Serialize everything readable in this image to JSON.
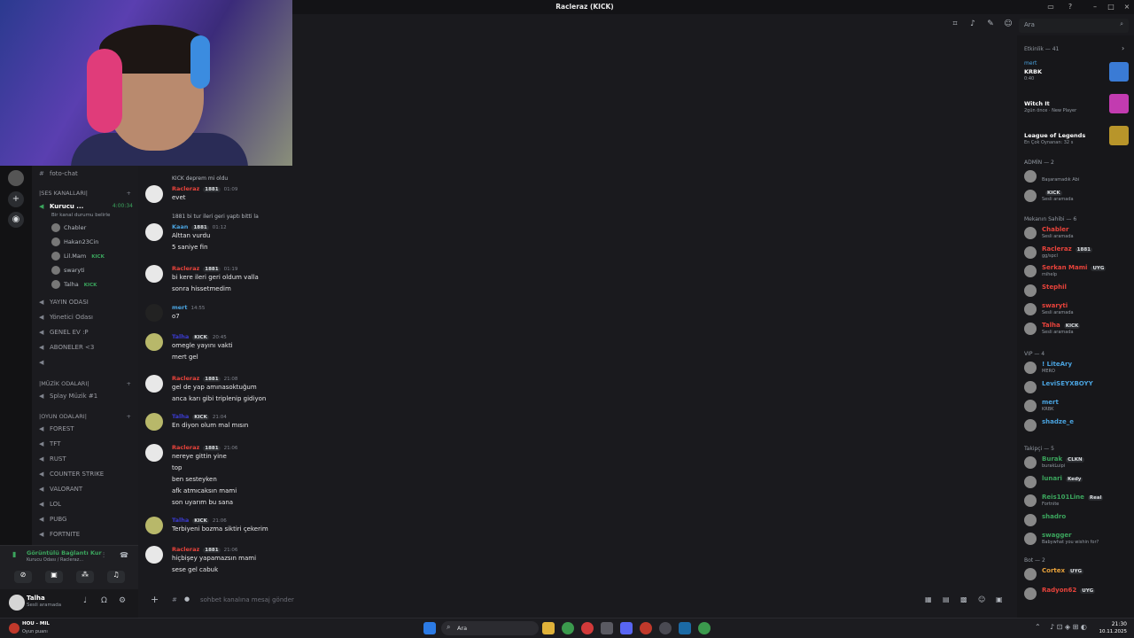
{
  "window": {
    "title": "Racleraz (KICK)"
  },
  "channel": {
    "name": "foto-chat",
    "composer_placeholder": "sohbet kanalına mesaj gönder"
  },
  "search": {
    "placeholder": "Ara"
  },
  "sidebar": {
    "top_channel": "foto-chat",
    "categories": {
      "ses": "|SES KANALLARI|",
      "muzik": "|MÜZİK ODALARI|",
      "oyun": "|OYUN ODALARI|"
    },
    "active_voice": {
      "name": "Kurucu ...",
      "time": "4:00:34",
      "status": "Bir kanal durumu belirle"
    },
    "voice_users": [
      {
        "name": "Chabler",
        "badge": ""
      },
      {
        "name": "Hakan23Cin",
        "badge": ""
      },
      {
        "name": "Lil.Mam",
        "badge": "KICK"
      },
      {
        "name": "swaryti",
        "badge": ""
      },
      {
        "name": "Talha",
        "badge": "KICK"
      }
    ],
    "channels": [
      "YAYIN ODASI",
      "Yönetici Odası",
      "GENEL EV :P",
      "ABONELER <3",
      ""
    ],
    "music_channels": [
      "Splay Müzik #1"
    ],
    "game_channels": [
      "FOREST",
      "TFT",
      "RUST",
      "COUNTER STRIKE",
      "VALORANT",
      "LOL",
      "PUBG",
      "FORTNITE"
    ]
  },
  "voice_connection": {
    "status": "Görüntülü Bağlantı Kur",
    "detail": "Kurucu Odası / Racleraz..."
  },
  "user": {
    "name": "Talha",
    "status": "Sesli aramada"
  },
  "messages": [
    {
      "reply": "KICK  deprem mi oldu",
      "author": "Racleraz",
      "badge": "1881",
      "time": "01:09",
      "lines": [
        "evet"
      ],
      "color": "#e8433b"
    },
    {
      "reply": "1881  bi tur ileri geri yaptı bitti la",
      "author": "Kaan",
      "badge": "1881",
      "time": "01:12",
      "lines": [
        "Alttan vurdu",
        "5 saniye fin"
      ],
      "color": "#4aa3df"
    },
    {
      "reply": "",
      "author": "Racleraz",
      "badge": "1881",
      "time": "01:19",
      "lines": [
        "bi kere ileri geri oldum valla",
        "sonra hissetmedim"
      ],
      "color": "#e8433b"
    },
    {
      "reply": "",
      "author": "mert",
      "badge": "",
      "time": "14:55",
      "lines": [
        "o7"
      ],
      "color": "#4aa3df"
    },
    {
      "reply": "",
      "author": "Talha",
      "badge": "KICK",
      "time": "20:45",
      "lines": [
        "omegle yayını vakti",
        "mert gel"
      ],
      "color": "#3b3bd0"
    },
    {
      "reply": "",
      "author": "Racleraz",
      "badge": "1881",
      "time": "21:08",
      "lines": [
        "gel de yap amınasoktuğum",
        "anca karı gibi triplenip gidiyon"
      ],
      "color": "#e8433b"
    },
    {
      "reply": "",
      "author": "Talha",
      "badge": "KICK",
      "time": "21:04",
      "lines": [
        "En diyon olum mal mısın"
      ],
      "color": "#3b3bd0"
    },
    {
      "reply": "",
      "author": "Racleraz",
      "badge": "1881",
      "time": "21:06",
      "lines": [
        "nereye gittin yine",
        "top",
        "ben sesteyken",
        "afk atmıcaksın mami",
        "son uyarım bu sana"
      ],
      "color": "#e8433b"
    },
    {
      "reply": "",
      "author": "Talha",
      "badge": "KICK",
      "time": "21:06",
      "lines": [
        "Terbiyeni bozma siktiri çekerim"
      ],
      "color": "#3b3bd0"
    },
    {
      "reply": "",
      "author": "Racleraz",
      "badge": "1881",
      "time": "21:06",
      "lines": [
        "hiçbişey yapamazsın mami",
        "sese gel cabuk"
      ],
      "color": "#e8433b"
    }
  ],
  "members": {
    "activity_header": "Etkinlik — 41",
    "activities": [
      {
        "user": "mert",
        "game": "KRBK",
        "detail": "0:40",
        "color": "#4aa3df",
        "img": "#3a7bd5"
      },
      {
        "user": "",
        "game": "Witch It",
        "detail": "2gün önce · New Player",
        "color": "#e8433b",
        "img": "#c23bb0"
      },
      {
        "user": "",
        "game": "League of Legends",
        "detail": "En Çok Oynanan: 32 s",
        "color": "#e8433b",
        "img": "#b8952a"
      }
    ],
    "sections": [
      {
        "title": "ADMİN — 2",
        "items": [
          {
            "name": "",
            "status": "Başaramadık Abi",
            "color": "#3b3bd0",
            "badge": ""
          },
          {
            "name": "",
            "status": "Sesli aramada",
            "color": "#3b3bd0",
            "badge": "KICK"
          }
        ]
      },
      {
        "title": "Mekanın Sahibi — 6",
        "items": [
          {
            "name": "Chabler",
            "status": "Sesli aramada",
            "color": "#e8433b",
            "badge": ""
          },
          {
            "name": "Racleraz",
            "status": "gg/spcl",
            "color": "#e8433b",
            "badge": "1881"
          },
          {
            "name": "Serkan Mami",
            "status": "mihelp",
            "color": "#e8433b",
            "badge": "UYG"
          },
          {
            "name": "Stephil",
            "status": "",
            "color": "#e8433b",
            "badge": ""
          },
          {
            "name": "swaryti",
            "status": "Sesli aramada",
            "color": "#e8433b",
            "badge": ""
          },
          {
            "name": "Talha",
            "status": "Sesli aramada",
            "color": "#e8433b",
            "badge": "KICK"
          }
        ]
      },
      {
        "title": "VIP — 4",
        "items": [
          {
            "name": "! LiteAry",
            "status": "MERO",
            "color": "#4aa3df",
            "badge": ""
          },
          {
            "name": "LeviSEYXBOYY",
            "status": "",
            "color": "#4aa3df",
            "badge": ""
          },
          {
            "name": "mert",
            "status": "KRBK",
            "color": "#4aa3df",
            "badge": ""
          },
          {
            "name": "shadze_e",
            "status": "",
            "color": "#4aa3df",
            "badge": ""
          }
        ]
      },
      {
        "title": "Takipçi — 5",
        "items": [
          {
            "name": "Burak",
            "status": "burakLuipi",
            "color": "#3ba55d",
            "badge": "CLKN"
          },
          {
            "name": "lunari",
            "status": "",
            "color": "#3ba55d",
            "badge": "Kedy"
          },
          {
            "name": "Reis101Line",
            "status": "Fortnite",
            "color": "#3ba55d",
            "badge": "Real"
          },
          {
            "name": "shadro",
            "status": "",
            "color": "#3ba55d",
            "badge": ""
          },
          {
            "name": "swagger",
            "status": "Babywhat you wishin for?",
            "color": "#3ba55d",
            "badge": ""
          }
        ]
      },
      {
        "title": "Bot — 2",
        "items": [
          {
            "name": "Cortex",
            "status": "",
            "color": "#e8a23b",
            "badge": "UYG"
          },
          {
            "name": "Radyon62",
            "status": "",
            "color": "#e8433b",
            "badge": "UYG"
          }
        ]
      }
    ]
  },
  "taskbar": {
    "weather_title": "HOU - MIL",
    "weather_sub": "Oyun puanı",
    "search": "Ara",
    "time": "21:30",
    "date": "10.11.2025"
  },
  "colors": {
    "accent": "#5865f2",
    "online": "#3ba55d",
    "danger": "#e8433b"
  }
}
